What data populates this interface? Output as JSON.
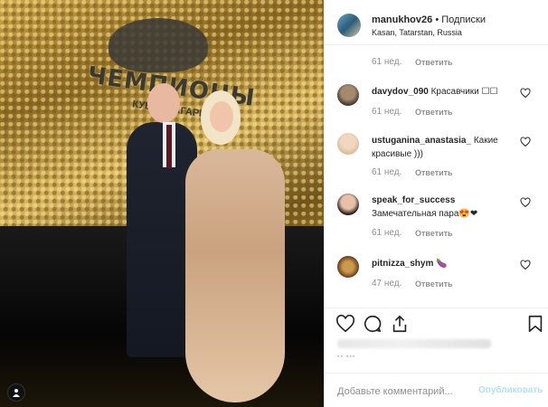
{
  "photo": {
    "logo_text": "ЧЕМПИОНЫ",
    "logo_sub": "КУБОК ГАГАРИНА",
    "tag_icon": "person-tag-icon"
  },
  "header": {
    "username": "manukhov26",
    "separator": "•",
    "follow_label": "Подписки",
    "location": "Kasan, Tatarstan, Russia"
  },
  "comments": [
    {
      "user": "",
      "text": "",
      "time": "61 нед.",
      "reply": "Ответить"
    },
    {
      "user": "davydov_090",
      "text": "Красавчики ☐☐",
      "time": "61 нед.",
      "reply": "Ответить"
    },
    {
      "user": "ustuganina_anastasia_",
      "text": "Какие красивые )))",
      "time": "61 нед.",
      "reply": "Ответить"
    },
    {
      "user": "speak_for_success",
      "text": "Замечательная пара😍❤",
      "time": "61 нед.",
      "reply": "Ответить"
    },
    {
      "user": "pitnizza_shym",
      "text": "🍆",
      "time": "47 нед.",
      "reply": "Ответить"
    }
  ],
  "actions": {
    "like_icon": "heart-icon",
    "comment_icon": "comment-bubble-icon",
    "share_icon": "share-icon",
    "save_icon": "bookmark-icon"
  },
  "add_comment": {
    "placeholder": "Добавьте комментарий...",
    "publish_label": "Опубликовать"
  },
  "colors": {
    "publish_disabled": "#b2dffc",
    "muted_text": "#8e8e8e",
    "border": "#efefef"
  }
}
